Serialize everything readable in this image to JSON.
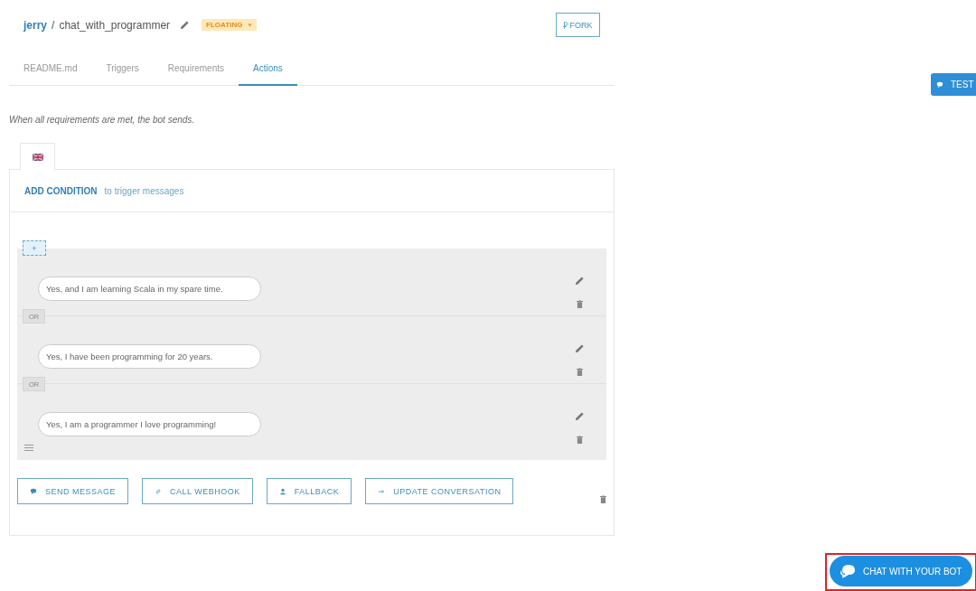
{
  "header": {
    "owner": "jerry",
    "separator": "/",
    "bot_name": "chat_with_programmer",
    "status": "FLOATING",
    "fork_button": "FORK"
  },
  "tabs": [
    {
      "label": "README.md",
      "selected": false
    },
    {
      "label": "Triggers",
      "selected": false
    },
    {
      "label": "Requirements",
      "selected": false
    },
    {
      "label": "Actions",
      "selected": true
    }
  ],
  "intro": "When all requirements are met, the bot sends.",
  "condition": {
    "link": "ADD CONDITION",
    "hint": "to trigger messages"
  },
  "add_button": "+",
  "messages": [
    {
      "text": "Yes, and I am learning Scala in my spare time."
    },
    {
      "connector": "OR",
      "text": "Yes, I have been programming for 20 years."
    },
    {
      "connector": "OR",
      "text": "Yes, I am a programmer I love programming!"
    }
  ],
  "action_buttons": [
    {
      "kind": "send",
      "label": "SEND MESSAGE"
    },
    {
      "kind": "webhook",
      "label": "CALL WEBHOOK"
    },
    {
      "kind": "fallback",
      "label": "FALLBACK"
    },
    {
      "kind": "update",
      "label": "UPDATE CONVERSATION"
    }
  ],
  "test_button": "TEST",
  "chat_button": {
    "label": "CHAT WITH YOUR BOT",
    "highlighted": true
  }
}
